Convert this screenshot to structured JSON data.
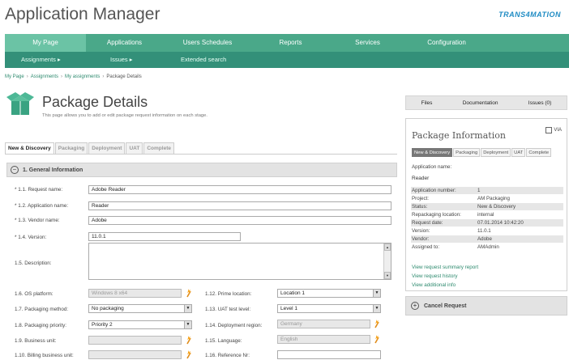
{
  "app": {
    "title": "Application Manager",
    "brand": "TRANS4MATION"
  },
  "main_nav": [
    {
      "label": "My Page",
      "active": true
    },
    {
      "label": "Applications"
    },
    {
      "label": "Users Schedules"
    },
    {
      "label": "Reports"
    },
    {
      "label": "Services"
    },
    {
      "label": "Configuration"
    }
  ],
  "sub_nav": [
    {
      "label": "Assignments ▸"
    },
    {
      "label": "Issues ▸"
    },
    {
      "label": "Extended search"
    }
  ],
  "breadcrumb": [
    "My Page",
    "Assignments",
    "My assignments",
    "Package Details"
  ],
  "page": {
    "title": "Package Details",
    "subtitle": "This page allows you to add or edit package request information on each stage."
  },
  "tabs": [
    "New & Discovery",
    "Packaging",
    "Deployment",
    "UAT",
    "Complete"
  ],
  "section": {
    "title": "1. General Information",
    "toggle": "–"
  },
  "form": {
    "request_name": {
      "label": "* 1.1. Request name:",
      "value": "Adobe Reader"
    },
    "application_name": {
      "label": "* 1.2. Application name:",
      "value": "Reader"
    },
    "vendor_name": {
      "label": "* 1.3. Vendor name:",
      "value": "Adobe"
    },
    "version": {
      "label": "* 1.4. Version:",
      "value": "11.0.1"
    },
    "description": {
      "label": "1.5. Description:",
      "value": ""
    },
    "os_platform": {
      "label": "1.6. OS platform:",
      "value": "Windows 8 x64"
    },
    "packaging_method": {
      "label": "1.7. Packaging method:",
      "value": "No packaging"
    },
    "packaging_priority": {
      "label": "1.8. Packaging priority:",
      "value": "Priority 2"
    },
    "business_unit": {
      "label": "1.9. Business unit:",
      "value": ""
    },
    "billing_business_unit": {
      "label": "1.10. Billing business unit:",
      "value": ""
    },
    "prime_location": {
      "label": "1.12. Prime location:",
      "value": "Location 1"
    },
    "uat_test_level": {
      "label": "1.13. UAT test level:",
      "value": "Level 1"
    },
    "deployment_region": {
      "label": "1.14. Deployment region:",
      "value": "Germany"
    },
    "language": {
      "label": "1.15. Language:",
      "value": "English"
    },
    "reference_nr": {
      "label": "1.16. Reference Nr:",
      "value": ""
    }
  },
  "side_tabs": [
    "Files",
    "Documentation",
    "Issues (0)"
  ],
  "info": {
    "title": "Package Information",
    "via_label": "VIA",
    "mini_tabs": [
      "New & Discovery",
      "Packaging",
      "Deployment",
      "UAT",
      "Complete"
    ],
    "app_name_label": "Application name:",
    "app_name_value": "Reader",
    "rows": [
      {
        "k": "Application number:",
        "v": "1"
      },
      {
        "k": "Project:",
        "v": "AM Packaging"
      },
      {
        "k": "Status:",
        "v": "New & Discovery"
      },
      {
        "k": "Repackaging location:",
        "v": "internal"
      },
      {
        "k": "Request date:",
        "v": "07.01.2014 10:42:20"
      },
      {
        "k": "Version:",
        "v": "11.0.1"
      },
      {
        "k": "Vendor:",
        "v": "Adobe"
      },
      {
        "k": "Assigned to:",
        "v": "AMAdmin"
      }
    ],
    "links": [
      "View request summary report",
      "View request history",
      "View additional info"
    ]
  },
  "cancel": {
    "label": "Cancel Request",
    "icon": "+"
  },
  "icons": {
    "page_icon": "package-box-icon",
    "magic_wand": "magic-wand-icon",
    "select_arrow": "dropdown-arrow-icon"
  },
  "colors": {
    "nav": "#4aa889",
    "nav_active": "#6bc3a5",
    "subnav": "#339079",
    "link": "#2d8a6e",
    "brand": "#1e8bc3"
  }
}
